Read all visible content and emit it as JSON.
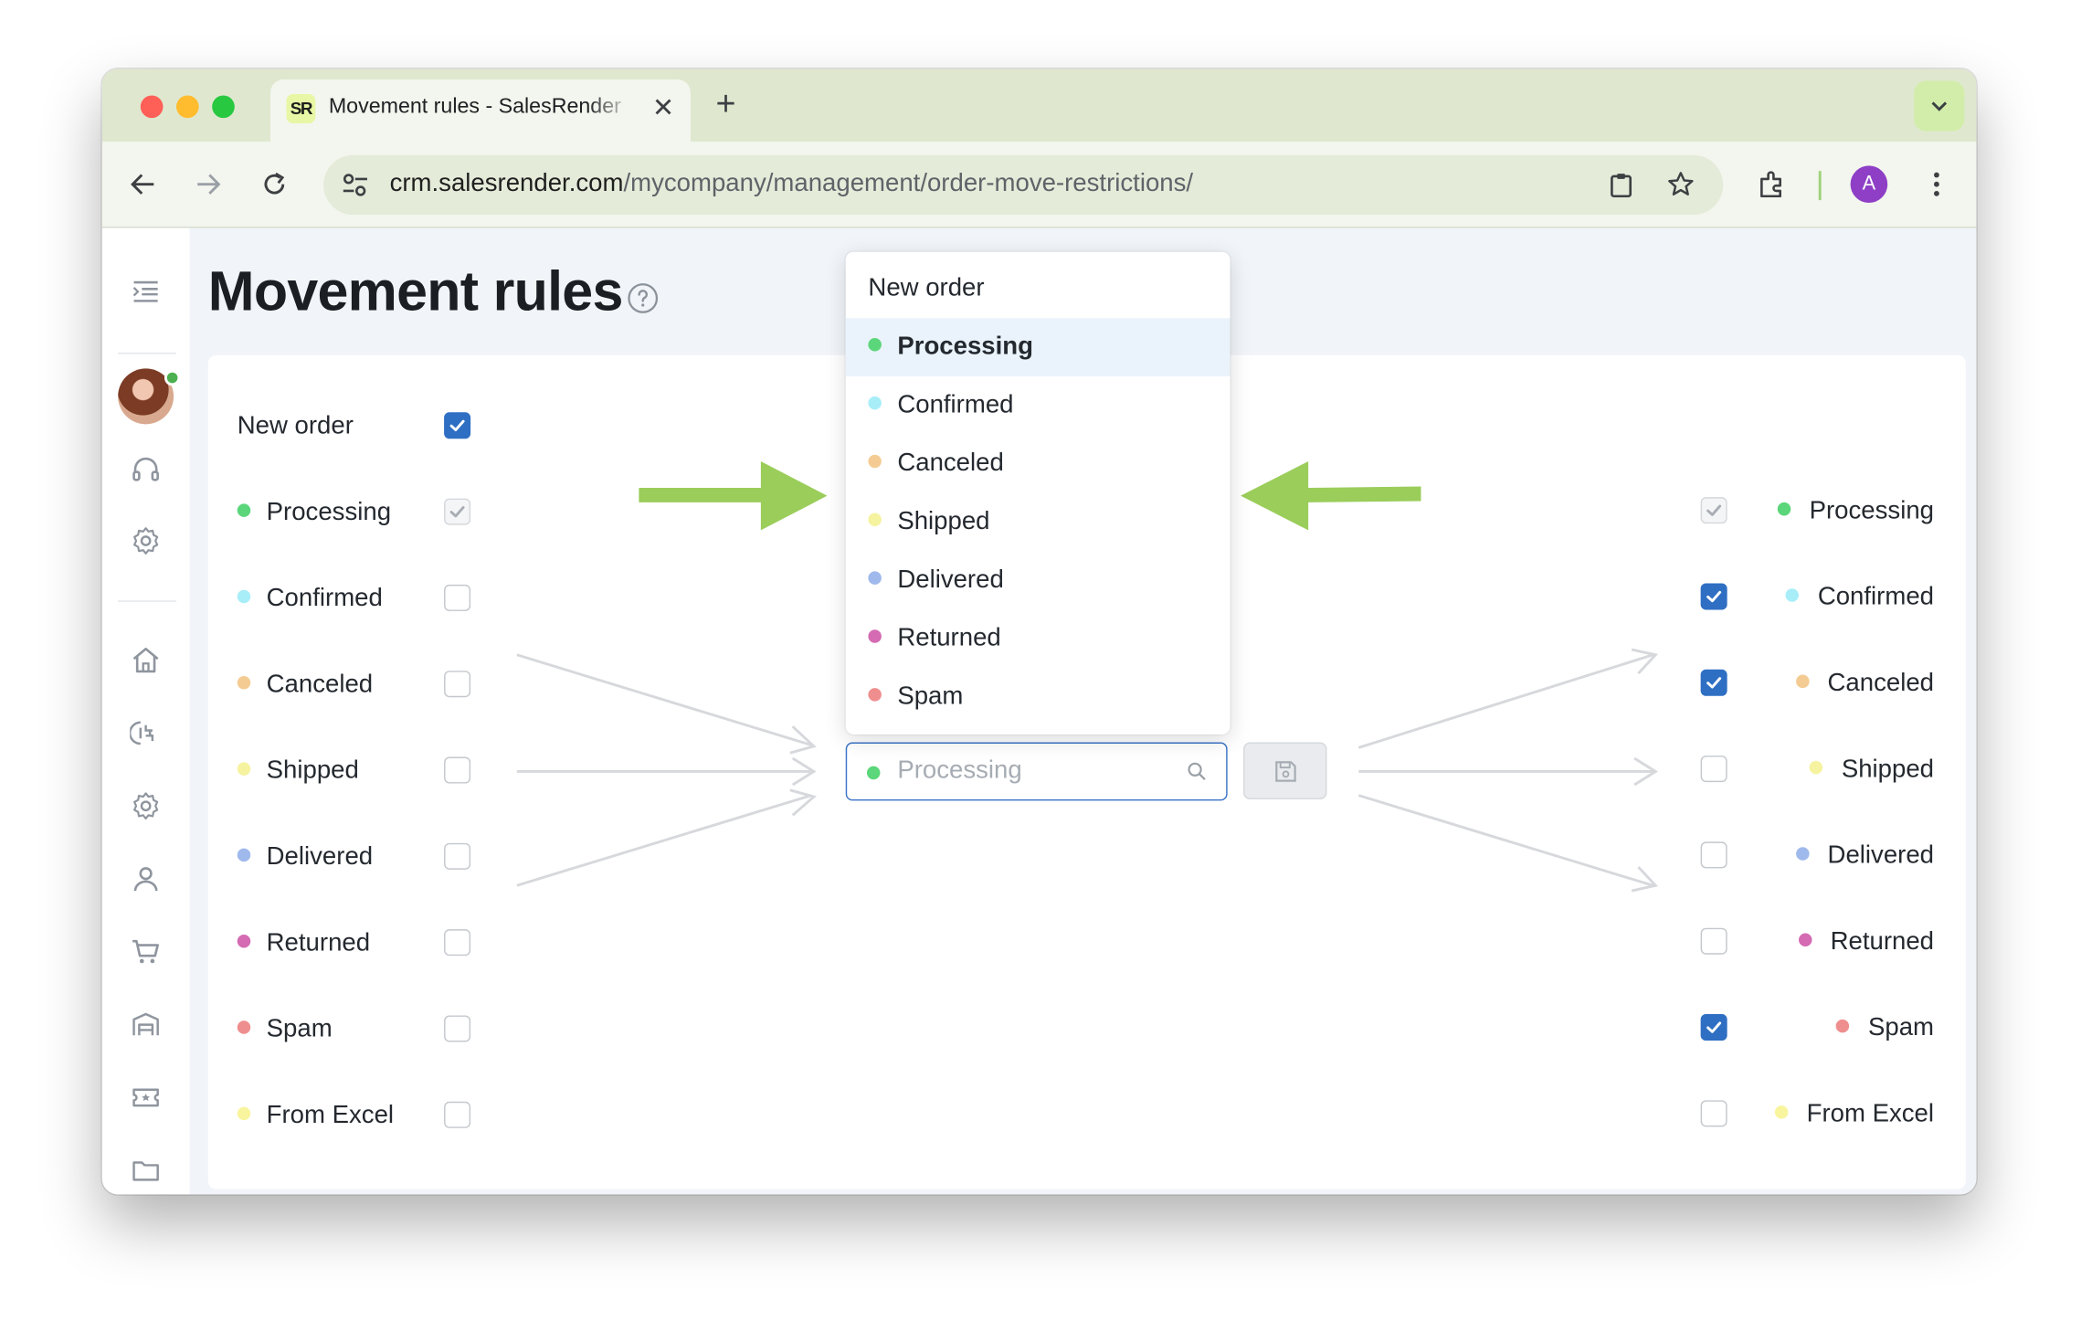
{
  "browser": {
    "tab_title": "Movement rules - SalesRender",
    "tab_logo": "SR",
    "new_tab": "+",
    "url_host": "crm.salesrender.com",
    "url_path": "/mycompany/management/order-move-restrictions/",
    "profile_initial": "A"
  },
  "page": {
    "title": "Movement rules"
  },
  "colors": {
    "accent": "#2f6fc3",
    "annotation_arrow": "#9acd5a",
    "processing": "#5cd67a",
    "confirmed": "#a8eef8",
    "canceled": "#f4cc93",
    "shipped": "#f6f3a0",
    "delivered": "#9fb9ec",
    "returned": "#d46bb3",
    "spam": "#ef8e8e",
    "from_excel": "#f8f59e"
  },
  "left_statuses": [
    {
      "label": "New order",
      "dot": null,
      "state": "checked"
    },
    {
      "label": "Processing",
      "dot": "#5cd67a",
      "state": "disabled"
    },
    {
      "label": "Confirmed",
      "dot": "#a8eef8",
      "state": "unchecked"
    },
    {
      "label": "Canceled",
      "dot": "#f4cc93",
      "state": "unchecked"
    },
    {
      "label": "Shipped",
      "dot": "#f6f3a0",
      "state": "unchecked"
    },
    {
      "label": "Delivered",
      "dot": "#9fb9ec",
      "state": "unchecked"
    },
    {
      "label": "Returned",
      "dot": "#d46bb3",
      "state": "unchecked"
    },
    {
      "label": "Spam",
      "dot": "#ef8e8e",
      "state": "unchecked"
    },
    {
      "label": "From Excel",
      "dot": "#f8f59e",
      "state": "unchecked"
    }
  ],
  "right_statuses": [
    {
      "label": "Processing",
      "dot": "#5cd67a",
      "state": "disabled"
    },
    {
      "label": "Confirmed",
      "dot": "#a8eef8",
      "state": "checked"
    },
    {
      "label": "Canceled",
      "dot": "#f4cc93",
      "state": "checked"
    },
    {
      "label": "Shipped",
      "dot": "#f6f3a0",
      "state": "unchecked"
    },
    {
      "label": "Delivered",
      "dot": "#9fb9ec",
      "state": "unchecked"
    },
    {
      "label": "Returned",
      "dot": "#d46bb3",
      "state": "unchecked"
    },
    {
      "label": "Spam",
      "dot": "#ef8e8e",
      "state": "checked"
    },
    {
      "label": "From Excel",
      "dot": "#f8f59e",
      "state": "unchecked"
    }
  ],
  "status_select": {
    "value": "Processing",
    "dot": "#5cd67a",
    "options": [
      {
        "label": "New order",
        "dot": null,
        "active": false
      },
      {
        "label": "Processing",
        "dot": "#5cd67a",
        "active": true
      },
      {
        "label": "Confirmed",
        "dot": "#a8eef8",
        "active": false
      },
      {
        "label": "Canceled",
        "dot": "#f4cc93",
        "active": false
      },
      {
        "label": "Shipped",
        "dot": "#f6f3a0",
        "active": false
      },
      {
        "label": "Delivered",
        "dot": "#9fb9ec",
        "active": false
      },
      {
        "label": "Returned",
        "dot": "#d46bb3",
        "active": false
      },
      {
        "label": "Spam",
        "dot": "#ef8e8e",
        "active": false
      }
    ]
  },
  "sidebar_icons": [
    "menu-collapse-icon",
    "user-avatar",
    "headset-icon",
    "settings-icon",
    "home-icon",
    "integrations-icon",
    "settings-icon",
    "user-icon",
    "cart-icon",
    "warehouse-icon",
    "ticket-icon",
    "folder-icon"
  ]
}
